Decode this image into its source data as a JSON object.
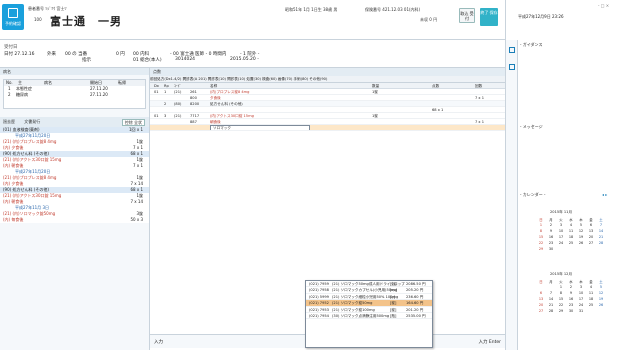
{
  "header": {
    "logo_label": "予約確認",
    "patient_id": "患者番号 ｿｼﾞﾂｳ 宮士ﾂ",
    "patient_no": "100",
    "patient_name": "富士通　一男",
    "birth": "昭和51年 1月 1日生 38歳 男",
    "insurance": "保険番号 421.12.03 01(内科)",
    "sub": "未収 0 円",
    "btn_main": "取込\n受付",
    "btn_end": "終了\n保存"
  },
  "datetime": "平成27年12月9日 23:26",
  "info_bar": {
    "label": "受付日",
    "date": "日付 27.12.16",
    "col1": "外来",
    "col2": "00 の 当番",
    "col3": "0 円",
    "col4": "00 内科",
    "col5": "- 00 富士通 医師 - 0 時間内",
    "col6": "- 1 院外 -",
    "sub1": "指示",
    "sub2": "01 総合(本人)",
    "sub3": "3014024",
    "sub4": "2015.05.20 -",
    "row2label": "備考"
  },
  "left": {
    "panel1_title": "病名",
    "dx_headers": [
      "No.",
      "主",
      "病名",
      "開始日",
      "転帰"
    ],
    "dx_rows": [
      [
        "1",
        "",
        "本態性症",
        "27.11.20",
        ""
      ],
      [
        "2",
        "",
        "糖尿病",
        "27.11.20",
        ""
      ]
    ],
    "panel2_title": "過去歴",
    "panel2_sub": "文書発行",
    "panel2_btn": "控除 全状",
    "history": [
      {
        "type": "sec",
        "text": "(01) 血液検査(薬剤)",
        "value": "1回 x 1"
      },
      {
        "type": "date",
        "text": "平成27年11月20日"
      },
      {
        "type": "item",
        "text": "(21) (内)プロプレス錠8 4mg",
        "value": "1錠"
      },
      {
        "type": "sub",
        "text": "(内)  夕食後",
        "value": "7 x 1"
      },
      {
        "type": "sec",
        "text": "(90) 処方せん料 (その他)",
        "value": "68 x 1"
      },
      {
        "type": "item",
        "text": "(21) (内)アクトス30口錠 15mg",
        "value": "1錠"
      },
      {
        "type": "sub",
        "text": "(内)  朝食後",
        "value": "7 x 1"
      },
      {
        "type": "date",
        "text": "平成27年11月20日"
      },
      {
        "type": "item",
        "text": "(21) (内)プロプレス錠8 4mg",
        "value": "1錠"
      },
      {
        "type": "sub",
        "text": "(内)  夕食後",
        "value": "7 x 14"
      },
      {
        "type": "sec",
        "text": "(90) 処方せん料 (その他)",
        "value": "68 x 1"
      },
      {
        "type": "item",
        "text": "(21) (内)アクトス30口錠 15mg",
        "value": "1錠"
      },
      {
        "type": "sub",
        "text": "(内)  朝食後",
        "value": "7 x 14"
      },
      {
        "type": "date",
        "text": "平成27年11月 3日"
      },
      {
        "type": "item",
        "text": "(21) (内)ソロマック錠50mg",
        "value": "3錠"
      },
      {
        "type": "sub",
        "text": "(内)  毎食後",
        "value": "50 x 3"
      }
    ]
  },
  "main": {
    "header_label": "点数",
    "tabs": "前回処方(Dx1-4/2)  問診表(A 201)  問診表(10) 問診表(10)  処置(30)  検査(60)  画像(70)  手術(80)  その他(90)",
    "grid_headers": [
      "Dx",
      "Rp",
      "ｺｰﾄﾞ",
      "名称",
      "数量",
      "点数",
      "回数"
    ],
    "rows": [
      {
        "dx": "01",
        "rp": "1",
        "code": "(21)",
        "kind": "261",
        "name": "(内)プロプレス錠8 4mg",
        "qty": "1錠",
        "pt": "",
        "cnt": ""
      },
      {
        "dx": "",
        "rp": "",
        "code": "",
        "kind": "800",
        "name": "夕食後",
        "qty": "",
        "pt": "",
        "cnt": "7 x 1"
      },
      {
        "dx": "",
        "rp": "2",
        "code": "(80)",
        "kind": "8200",
        "name": "処方せん料 (その他)",
        "qty": "",
        "pt": "",
        "cnt": "",
        "highlight": true
      },
      {
        "dx": "",
        "rp": "",
        "code": "",
        "kind": "",
        "name": "",
        "qty": "",
        "pt": "68 x 1",
        "cnt": ""
      },
      {
        "dx": "01",
        "rp": "3",
        "code": "(21)",
        "kind": "7717",
        "name": "(内)アクトス30口錠 15mg",
        "qty": "1錠",
        "pt": "",
        "cnt": ""
      },
      {
        "dx": "",
        "rp": "",
        "code": "",
        "kind": "887",
        "name": "朝食後",
        "qty": "",
        "pt": "",
        "cnt": "7 x 1"
      },
      {
        "dx": "",
        "rp": "",
        "code": "",
        "kind": "",
        "name": "ソロマック",
        "qty": "",
        "pt": "",
        "cnt": "",
        "edit": true
      }
    ],
    "input_label": "入力",
    "bottom_label": "入力 Enter"
  },
  "dropdown": {
    "items": [
      {
        "code": "(021) 7959",
        "name": "(21) ソロマック50mg成人用ドライシロップ",
        "unit": "[包]",
        "price": "2086.50 円"
      },
      {
        "code": "(021) 7958",
        "name": "(21) ソロマックカプセル(小児用)50mg",
        "unit": "[cp]",
        "price": "205.20 円"
      },
      {
        "code": "(021) 5999",
        "name": "(21) ソロマック細粒小児用50%  100mg",
        "unit": "[g]",
        "price": "236.60 円"
      },
      {
        "code": "(021) 7952",
        "name": "(21) ソロマック錠50mg",
        "unit": "[錠]",
        "price": "164.60 円",
        "selected": true
      },
      {
        "code": "(021) 7953",
        "name": "(21) ソロマック錠100mg",
        "unit": "[錠]",
        "price": "201.20 円"
      },
      {
        "code": "(021) 7954",
        "name": "(30) ソロマック点滴静注用500mg",
        "unit": "[瓶]",
        "price": "2535.00 円"
      }
    ]
  },
  "right": {
    "guidance_title": "- ガイダンス",
    "message_title": "- メッセージ",
    "calendar_title": "- カレンダー -",
    "cal1_title": "2015年 11月",
    "cal2_title": "2015年 12月",
    "dow": [
      "日",
      "月",
      "火",
      "水",
      "木",
      "金",
      "土"
    ],
    "cal1": [
      [
        "1",
        "2",
        "3",
        "4",
        "5",
        "6",
        "7"
      ],
      [
        "8",
        "9",
        "10",
        "11",
        "12",
        "13",
        "14"
      ],
      [
        "15",
        "16",
        "17",
        "18",
        "19",
        "20",
        "21"
      ],
      [
        "22",
        "23",
        "24",
        "25",
        "26",
        "27",
        "28"
      ],
      [
        "29",
        "30",
        "",
        "",
        "",
        "",
        ""
      ]
    ],
    "cal2": [
      [
        "",
        "",
        "1",
        "2",
        "3",
        "4",
        "5"
      ],
      [
        "6",
        "7",
        "8",
        "9",
        "10",
        "11",
        "12"
      ],
      [
        "13",
        "14",
        "15",
        "16",
        "17",
        "18",
        "19"
      ],
      [
        "20",
        "21",
        "22",
        "23",
        "24",
        "25",
        "26"
      ],
      [
        "27",
        "28",
        "29",
        "30",
        "31",
        "",
        ""
      ]
    ],
    "window_controls": "- □ ×"
  },
  "colors": {
    "accent": "#31b2c8",
    "logo": "#1aa0dc",
    "selected": "#f3c38a",
    "highlight": "#fde7c8"
  }
}
